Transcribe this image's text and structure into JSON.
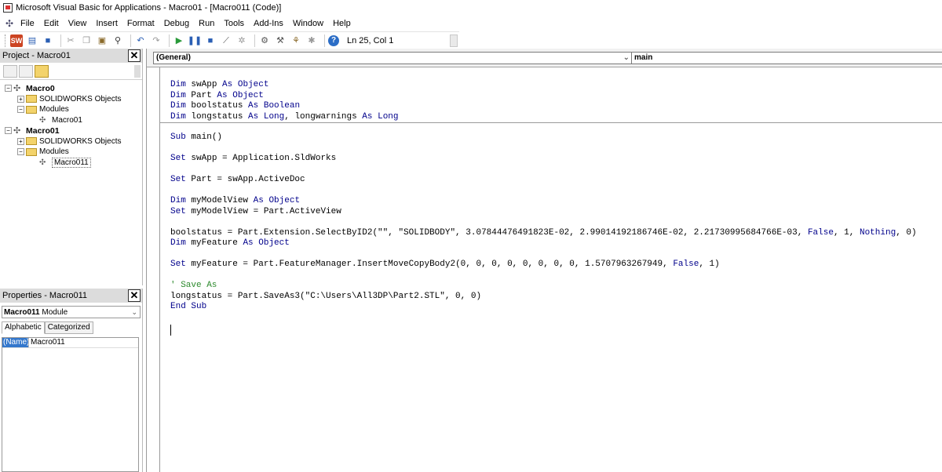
{
  "title_bar": {
    "text": "Microsoft Visual Basic for Applications - Macro01 - [Macro011 (Code)]"
  },
  "menu": {
    "items": [
      {
        "label": "File",
        "name": "menu-file"
      },
      {
        "label": "Edit",
        "name": "menu-edit"
      },
      {
        "label": "View",
        "name": "menu-view"
      },
      {
        "label": "Insert",
        "name": "menu-insert"
      },
      {
        "label": "Format",
        "name": "menu-format"
      },
      {
        "label": "Debug",
        "name": "menu-debug"
      },
      {
        "label": "Run",
        "name": "menu-run"
      },
      {
        "label": "Tools",
        "name": "menu-tools"
      },
      {
        "label": "Add-Ins",
        "name": "menu-add-ins"
      },
      {
        "label": "Window",
        "name": "menu-window"
      },
      {
        "label": "Help",
        "name": "menu-help"
      }
    ]
  },
  "toolbar": {
    "cursor_position": "Ln 25, Col 1"
  },
  "project_pane": {
    "title": "Project - Macro01",
    "tree": {
      "macro0": "Macro0",
      "macro0_solidworks": "SOLIDWORKS Objects",
      "macro0_modules": "Modules",
      "macro0_module": "Macro01",
      "macro01": "Macro01",
      "macro01_solidworks": "SOLIDWORKS Objects",
      "macro01_modules": "Modules",
      "macro01_module": "Macro011"
    }
  },
  "properties_pane": {
    "title": "Properties - Macro011",
    "object_name": "Macro011",
    "object_type": "Module",
    "tab_alphabetic": "Alphabetic",
    "tab_categorized": "Categorized",
    "row_key": "(Name)",
    "row_value": "Macro011"
  },
  "code_window": {
    "object_combo": "(General)",
    "procedure_combo": "main",
    "declarations": [
      "Dim swApp As Object",
      "Dim Part As Object",
      "Dim boolstatus As Boolean",
      "Dim longstatus As Long, longwarnings As Long"
    ],
    "body": [
      "Sub main()",
      "",
      "Set swApp = Application.SldWorks",
      "",
      "Set Part = swApp.ActiveDoc",
      "",
      "Dim myModelView As Object",
      "Set myModelView = Part.ActiveView",
      "",
      "boolstatus = Part.Extension.SelectByID2(\"\", \"SOLIDBODY\", 3.07844476491823E-02, 2.99014192186746E-02, 2.21730995684766E-03, False, 1, Nothing, 0)",
      "Dim myFeature As Object",
      "",
      "Set myFeature = Part.FeatureManager.InsertMoveCopyBody2(0, 0, 0, 0, 0, 0, 0, 0, 1.5707963267949, False, 1)",
      "",
      "' Save As",
      "longstatus = Part.SaveAs3(\"C:\\Users\\All3DP\\Part2.STL\", 0, 0)",
      "End Sub"
    ]
  }
}
